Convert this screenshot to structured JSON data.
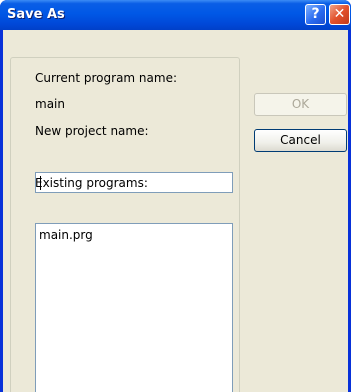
{
  "window": {
    "title": "Save As",
    "help_glyph": "?",
    "close_glyph": "✕"
  },
  "form": {
    "current_program_label": "Current program name:",
    "current_program_value": "main",
    "new_project_label": "New project name:",
    "new_project_value": "",
    "existing_programs_label": "Existing programs:",
    "existing_programs": [
      "main.prg"
    ]
  },
  "buttons": {
    "ok_label": "OK",
    "cancel_label": "Cancel"
  },
  "colors": {
    "titlebar": "#0058e6",
    "dialog_face": "#ece9d8",
    "input_border": "#7f9db9"
  }
}
